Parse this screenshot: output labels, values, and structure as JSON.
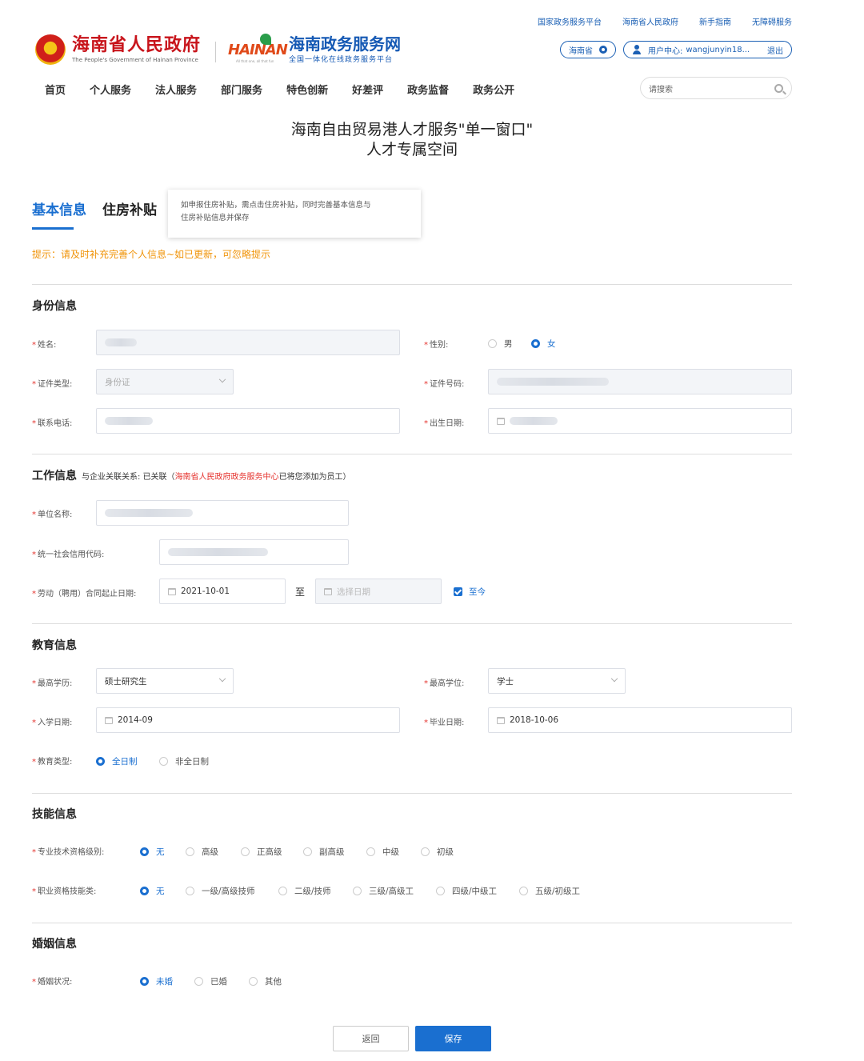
{
  "top_links": [
    "国家政务服务平台",
    "海南省人民政府",
    "新手指南",
    "无障碍服务"
  ],
  "gov_logo": {
    "cn": "海南省人民政府",
    "en": "The People's Government of Hainan Province"
  },
  "hainan_logo": {
    "mark": "HAINAN",
    "slogan": "All that one, all that fun",
    "cn": "海南政务服务网",
    "sub": "全国一体化在线政务服务平台"
  },
  "region": "海南省",
  "user": {
    "prefix": "用户中心:",
    "name": "wangjunyin18...",
    "logout": "退出"
  },
  "nav": [
    "首页",
    "个人服务",
    "法人服务",
    "部门服务",
    "特色创新",
    "好差评",
    "政务监督",
    "政务公开"
  ],
  "search": {
    "placeholder": "请搜索"
  },
  "page_title": {
    "line1": "海南自由贸易港人才服务\"单一窗口\"",
    "line2": "人才专属空间"
  },
  "tabs": {
    "basic": "基本信息",
    "housing": "住房补贴"
  },
  "tooltip": {
    "line1": "如申报住房补贴，需点击住房补贴，同时完善基本信息与",
    "line2": "住房补贴信息并保存"
  },
  "tip": "提示：请及时补充完善个人信息~如已更新，可忽略提示",
  "identity": {
    "title": "身份信息",
    "name_label": "姓名:",
    "gender_label": "性别:",
    "gender_options": [
      "男",
      "女"
    ],
    "id_type_label": "证件类型:",
    "id_type_value": "身份证",
    "id_no_label": "证件号码:",
    "phone_label": "联系电话:",
    "birth_label": "出生日期:"
  },
  "work": {
    "title": "工作信息",
    "relation_prefix": "与企业关联关系: 已关联（",
    "relation_org": "海南省人民政府政务服务中心",
    "relation_suffix": "已将您添加为员工）",
    "unit_label": "单位名称:",
    "credit_label": "统一社会信用代码:",
    "contract_label": "劳动（聘用）合同起止日期:",
    "contract_start": "2021-10-01",
    "to": "至",
    "end_placeholder": "选择日期",
    "until_now": "至今"
  },
  "education": {
    "title": "教育信息",
    "degree_edu_label": "最高学历:",
    "degree_edu_value": "硕士研究生",
    "degree_label": "最高学位:",
    "degree_value": "学士",
    "enroll_label": "入学日期:",
    "enroll_value": "2014-09",
    "grad_label": "毕业日期:",
    "grad_value": "2018-10-06",
    "type_label": "教育类型:",
    "type_options": [
      "全日制",
      "非全日制"
    ]
  },
  "skills": {
    "title": "技能信息",
    "tech_label": "专业技术资格级别:",
    "tech_options": [
      "无",
      "高级",
      "正高级",
      "副高级",
      "中级",
      "初级"
    ],
    "voc_label": "职业资格技能类:",
    "voc_options": [
      "无",
      "一级/高级技师",
      "二级/技师",
      "三级/高级工",
      "四级/中级工",
      "五级/初级工"
    ]
  },
  "marriage": {
    "title": "婚姻信息",
    "status_label": "婚姻状况:",
    "options": [
      "未婚",
      "已婚",
      "其他"
    ]
  },
  "buttons": {
    "back": "返回",
    "save": "保存"
  },
  "colors": {
    "primary": "#1a6fd0",
    "brand_red": "#c8141b",
    "warning": "#f0940a"
  }
}
